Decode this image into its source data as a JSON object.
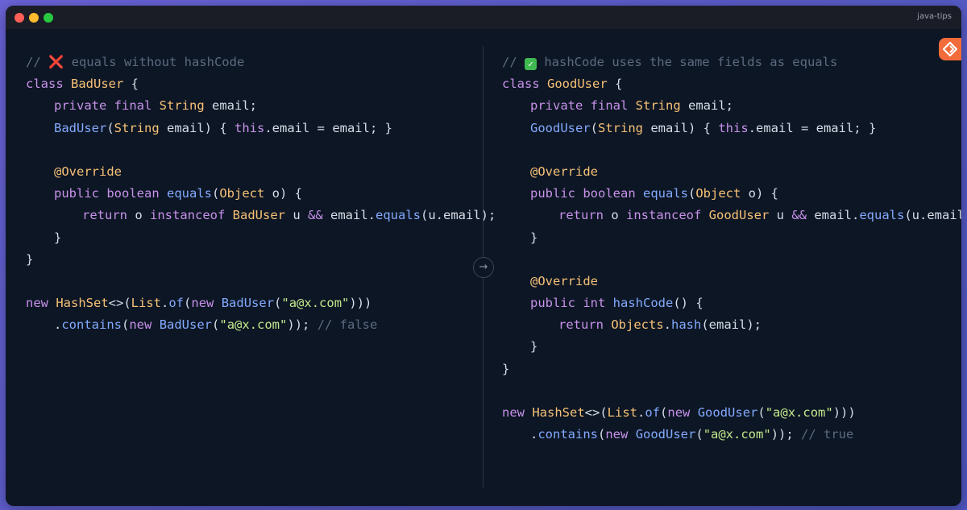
{
  "window": {
    "title": "java-tips",
    "controls": [
      "close",
      "minimize",
      "maximize"
    ]
  },
  "divider_arrow": "→",
  "brand_icon": "orange-rhombus-logo-icon",
  "colors": {
    "background": "#0d1624",
    "keyword": "#c792ea",
    "type": "#f6c177",
    "function": "#82aaff",
    "string": "#c3e88d",
    "comment": "#5c6a80",
    "text": "#d7dde8"
  },
  "left_panel": {
    "comment_prefix": "// ",
    "comment_mark": "❌",
    "comment_text": " equals without hashCode",
    "class_kw": "class",
    "class_name": "BadUser",
    "open_brace": " {",
    "close_brace": "}",
    "private_final": "private final",
    "string_type": "String",
    "email_field": " email;",
    "ctor_name": "BadUser",
    "ctor_paren": "(",
    "ctor_string": "String",
    "ctor_rest": " email) { ",
    "this_kw": "this",
    "ctor_body": ".email = email; }",
    "override": "@Override",
    "public_boolean": "public boolean",
    "equals_name": "equals",
    "equals_paren": "(",
    "object_type": "Object",
    "equals_rest": " o) {",
    "return_kw": "return",
    "ret_o": " o ",
    "instanceof_kw": "instanceof",
    "ret_type": "BadUser",
    "ret_u": " u ",
    "and_op": "&&",
    "ret_email": " email.",
    "ret_equals": "equals",
    "ret_end": "(u.email);",
    "inner_close": "}",
    "new_kw": "new",
    "hashset": "HashSet",
    "diamond": "<>(",
    "list": "List",
    "dot": ".",
    "of_fn": "of",
    "paren": "(",
    "new_kw2": "new",
    "badctor": "BadUser",
    "str_val": "\"a@x.com\"",
    "close_parens": ")))",
    "contains_dot": ".",
    "contains_fn": "contains",
    "contains_paren": "(",
    "new_kw3": "new",
    "badctor2": "BadUser",
    "str_val2": "\"a@x.com\"",
    "contains_end": ")); ",
    "result_comment": "// false"
  },
  "right_panel": {
    "comment_prefix": "// ",
    "comment_mark": "✓",
    "comment_text": " hashCode uses the same fields as equals",
    "class_kw": "class",
    "class_name": "GoodUser",
    "open_brace": " {",
    "close_brace": "}",
    "private_final": "private final",
    "string_type": "String",
    "email_field": " email;",
    "ctor_name": "GoodUser",
    "ctor_paren": "(",
    "ctor_string": "String",
    "ctor_rest": " email) { ",
    "this_kw": "this",
    "ctor_body": ".email = email; }",
    "override": "@Override",
    "public_boolean": "public boolean",
    "equals_name": "equals",
    "equals_paren": "(",
    "object_type": "Object",
    "equals_rest": " o) {",
    "return_kw": "return",
    "ret_o": " o ",
    "instanceof_kw": "instanceof",
    "ret_type": "GoodUser",
    "ret_u": " u ",
    "and_op": "&&",
    "ret_email": " email.",
    "ret_equals": "equals",
    "ret_end": "(u.email);",
    "inner_close": "}",
    "override2": "@Override",
    "public_int": "public int",
    "hashcode_name": "hashCode",
    "hashcode_rest": "() {",
    "return_kw2": "return",
    "objects": " Objects",
    "hash_dot": ".",
    "hash_fn": "hash",
    "hash_end": "(email);",
    "inner_close2": "}",
    "new_kw": "new",
    "hashset": "HashSet",
    "diamond": "<>(",
    "list": "List",
    "dot": ".",
    "of_fn": "of",
    "paren": "(",
    "new_kw2": "new",
    "goodctor": "GoodUser",
    "str_val": "\"a@x.com\"",
    "close_parens": ")))",
    "contains_dot": ".",
    "contains_fn": "contains",
    "contains_paren": "(",
    "new_kw3": "new",
    "goodctor2": "GoodUser",
    "str_val2": "\"a@x.com\"",
    "contains_end": ")); ",
    "result_comment": "// true"
  }
}
